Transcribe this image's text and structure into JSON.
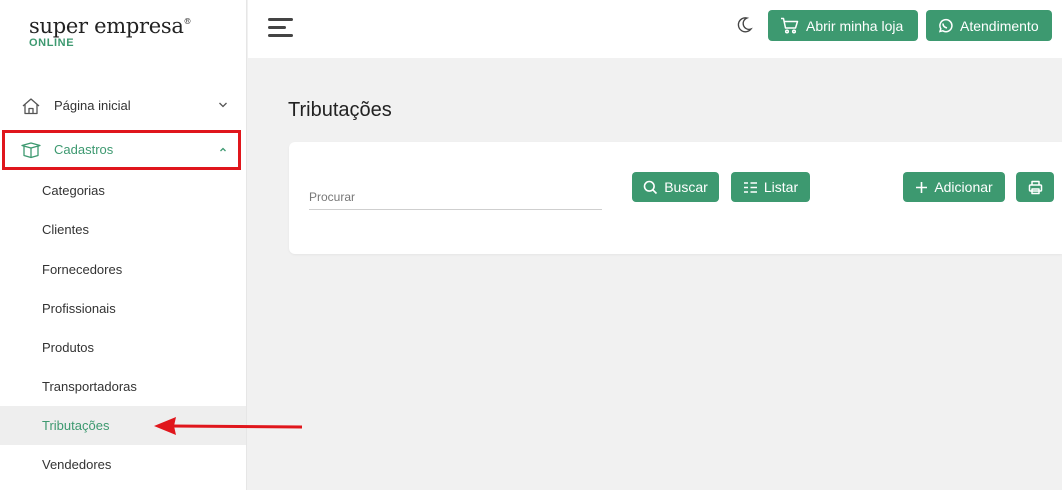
{
  "brand": {
    "name": "super empresa",
    "mark": "®",
    "tagline": "ONLINE"
  },
  "sidebar": {
    "items": [
      {
        "label": "Página inicial",
        "icon": "home-icon"
      },
      {
        "label": "Cadastros",
        "icon": "box-icon"
      }
    ],
    "subitems": [
      "Categorias",
      "Clientes",
      "Fornecedores",
      "Profissionais",
      "Produtos",
      "Transportadoras",
      "Tributações",
      "Vendedores"
    ],
    "active_subitem": "Tributações"
  },
  "header": {
    "open_store_label": "Abrir minha loja",
    "support_label": "Atendimento"
  },
  "main": {
    "title": "Tributações",
    "search": {
      "placeholder": "Procurar",
      "value": ""
    },
    "buttons": {
      "search": "Buscar",
      "list": "Listar",
      "add": "Adicionar"
    }
  },
  "colors": {
    "accent": "#3d9970",
    "annotation": "#e0161c",
    "background": "#f1f1f1"
  }
}
